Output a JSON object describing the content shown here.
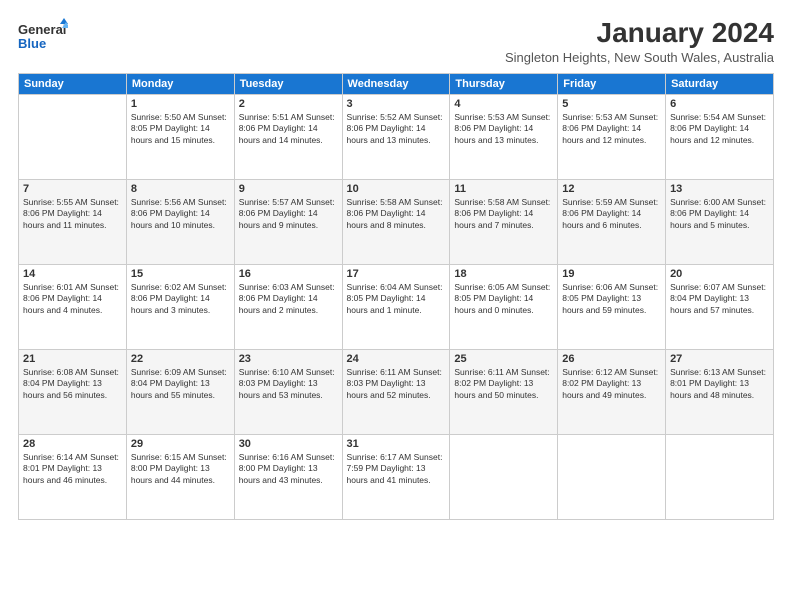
{
  "logo": {
    "general": "General",
    "blue": "Blue"
  },
  "title": "January 2024",
  "subtitle": "Singleton Heights, New South Wales, Australia",
  "days_header": [
    "Sunday",
    "Monday",
    "Tuesday",
    "Wednesday",
    "Thursday",
    "Friday",
    "Saturday"
  ],
  "weeks": [
    [
      {
        "day": "",
        "info": ""
      },
      {
        "day": "1",
        "info": "Sunrise: 5:50 AM\nSunset: 8:05 PM\nDaylight: 14 hours\nand 15 minutes."
      },
      {
        "day": "2",
        "info": "Sunrise: 5:51 AM\nSunset: 8:06 PM\nDaylight: 14 hours\nand 14 minutes."
      },
      {
        "day": "3",
        "info": "Sunrise: 5:52 AM\nSunset: 8:06 PM\nDaylight: 14 hours\nand 13 minutes."
      },
      {
        "day": "4",
        "info": "Sunrise: 5:53 AM\nSunset: 8:06 PM\nDaylight: 14 hours\nand 13 minutes."
      },
      {
        "day": "5",
        "info": "Sunrise: 5:53 AM\nSunset: 8:06 PM\nDaylight: 14 hours\nand 12 minutes."
      },
      {
        "day": "6",
        "info": "Sunrise: 5:54 AM\nSunset: 8:06 PM\nDaylight: 14 hours\nand 12 minutes."
      }
    ],
    [
      {
        "day": "7",
        "info": "Sunrise: 5:55 AM\nSunset: 8:06 PM\nDaylight: 14 hours\nand 11 minutes."
      },
      {
        "day": "8",
        "info": "Sunrise: 5:56 AM\nSunset: 8:06 PM\nDaylight: 14 hours\nand 10 minutes."
      },
      {
        "day": "9",
        "info": "Sunrise: 5:57 AM\nSunset: 8:06 PM\nDaylight: 14 hours\nand 9 minutes."
      },
      {
        "day": "10",
        "info": "Sunrise: 5:58 AM\nSunset: 8:06 PM\nDaylight: 14 hours\nand 8 minutes."
      },
      {
        "day": "11",
        "info": "Sunrise: 5:58 AM\nSunset: 8:06 PM\nDaylight: 14 hours\nand 7 minutes."
      },
      {
        "day": "12",
        "info": "Sunrise: 5:59 AM\nSunset: 8:06 PM\nDaylight: 14 hours\nand 6 minutes."
      },
      {
        "day": "13",
        "info": "Sunrise: 6:00 AM\nSunset: 8:06 PM\nDaylight: 14 hours\nand 5 minutes."
      }
    ],
    [
      {
        "day": "14",
        "info": "Sunrise: 6:01 AM\nSunset: 8:06 PM\nDaylight: 14 hours\nand 4 minutes."
      },
      {
        "day": "15",
        "info": "Sunrise: 6:02 AM\nSunset: 8:06 PM\nDaylight: 14 hours\nand 3 minutes."
      },
      {
        "day": "16",
        "info": "Sunrise: 6:03 AM\nSunset: 8:06 PM\nDaylight: 14 hours\nand 2 minutes."
      },
      {
        "day": "17",
        "info": "Sunrise: 6:04 AM\nSunset: 8:05 PM\nDaylight: 14 hours\nand 1 minute."
      },
      {
        "day": "18",
        "info": "Sunrise: 6:05 AM\nSunset: 8:05 PM\nDaylight: 14 hours\nand 0 minutes."
      },
      {
        "day": "19",
        "info": "Sunrise: 6:06 AM\nSunset: 8:05 PM\nDaylight: 13 hours\nand 59 minutes."
      },
      {
        "day": "20",
        "info": "Sunrise: 6:07 AM\nSunset: 8:04 PM\nDaylight: 13 hours\nand 57 minutes."
      }
    ],
    [
      {
        "day": "21",
        "info": "Sunrise: 6:08 AM\nSunset: 8:04 PM\nDaylight: 13 hours\nand 56 minutes."
      },
      {
        "day": "22",
        "info": "Sunrise: 6:09 AM\nSunset: 8:04 PM\nDaylight: 13 hours\nand 55 minutes."
      },
      {
        "day": "23",
        "info": "Sunrise: 6:10 AM\nSunset: 8:03 PM\nDaylight: 13 hours\nand 53 minutes."
      },
      {
        "day": "24",
        "info": "Sunrise: 6:11 AM\nSunset: 8:03 PM\nDaylight: 13 hours\nand 52 minutes."
      },
      {
        "day": "25",
        "info": "Sunrise: 6:11 AM\nSunset: 8:02 PM\nDaylight: 13 hours\nand 50 minutes."
      },
      {
        "day": "26",
        "info": "Sunrise: 6:12 AM\nSunset: 8:02 PM\nDaylight: 13 hours\nand 49 minutes."
      },
      {
        "day": "27",
        "info": "Sunrise: 6:13 AM\nSunset: 8:01 PM\nDaylight: 13 hours\nand 48 minutes."
      }
    ],
    [
      {
        "day": "28",
        "info": "Sunrise: 6:14 AM\nSunset: 8:01 PM\nDaylight: 13 hours\nand 46 minutes."
      },
      {
        "day": "29",
        "info": "Sunrise: 6:15 AM\nSunset: 8:00 PM\nDaylight: 13 hours\nand 44 minutes."
      },
      {
        "day": "30",
        "info": "Sunrise: 6:16 AM\nSunset: 8:00 PM\nDaylight: 13 hours\nand 43 minutes."
      },
      {
        "day": "31",
        "info": "Sunrise: 6:17 AM\nSunset: 7:59 PM\nDaylight: 13 hours\nand 41 minutes."
      },
      {
        "day": "",
        "info": ""
      },
      {
        "day": "",
        "info": ""
      },
      {
        "day": "",
        "info": ""
      }
    ]
  ]
}
